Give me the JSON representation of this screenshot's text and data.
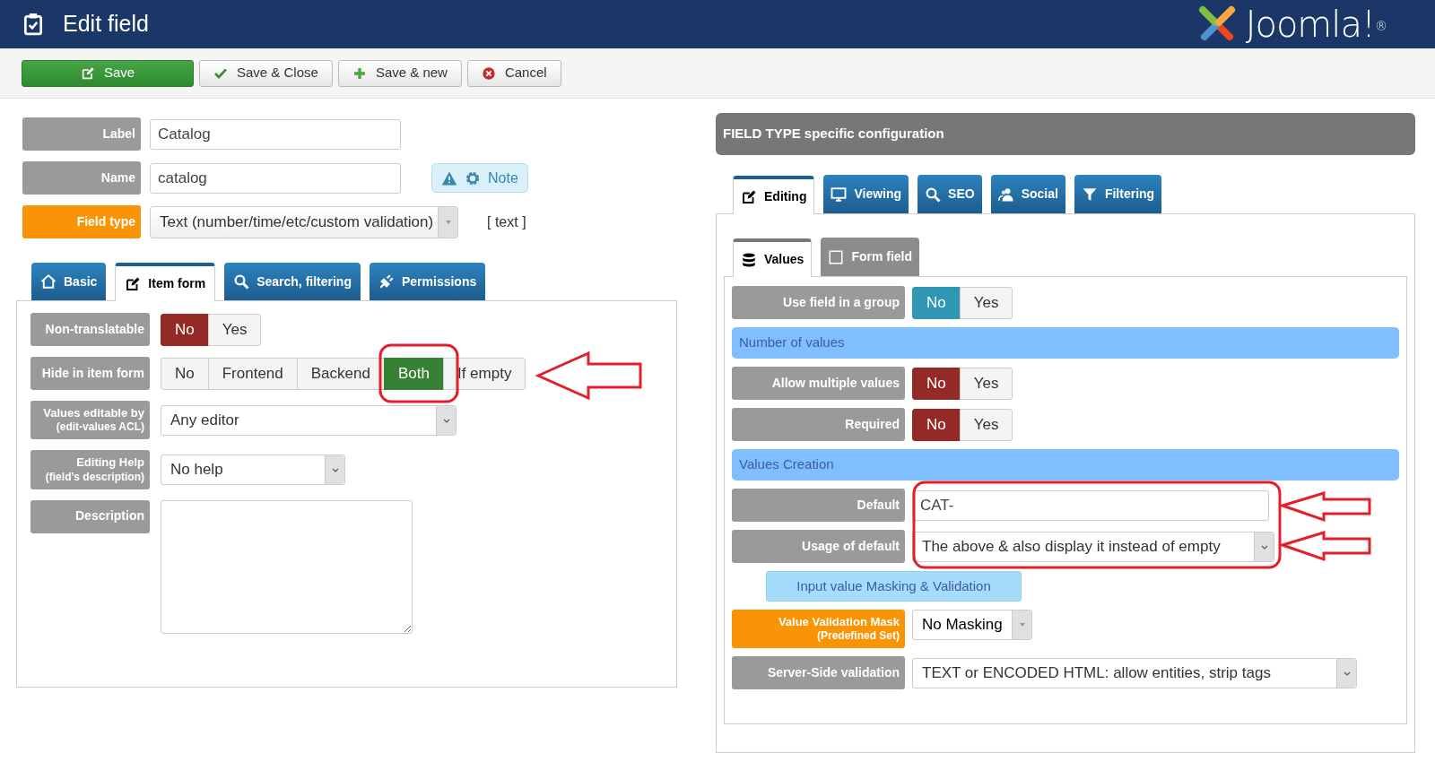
{
  "header": {
    "title": "Edit field",
    "logo_text": "Joomla!$^{®}$"
  },
  "toolbar": [
    {
      "label": "Save",
      "kind": "save"
    },
    {
      "label": "Save & Close",
      "kind": "close"
    },
    {
      "label": "Save & new",
      "kind": "new"
    },
    {
      "label": "Cancel",
      "kind": "cancel"
    }
  ],
  "left": {
    "fields": [
      {
        "label": "Label",
        "kind": "text",
        "value": "Catalog",
        "highlight": false
      },
      {
        "label": "Name",
        "kind": "text",
        "value": "catalog",
        "highlight": false,
        "note": "Note"
      },
      {
        "label": "Field type",
        "kind": "select",
        "value": "Text (number/time/etc/custom validation)",
        "highlight": true,
        "suffix": "[ text ]"
      }
    ],
    "tabs": [
      {
        "label": "Basic",
        "kind": "home",
        "selected": false
      },
      {
        "label": "Item form",
        "kind": "edit",
        "selected": true
      },
      {
        "label": "Search, filtering",
        "kind": "search",
        "selected": false
      },
      {
        "label": "Permissions",
        "kind": "plug",
        "selected": false
      }
    ],
    "rows": [
      {
        "label": "Non-translatable",
        "kind": "toggle",
        "color": "#942a25",
        "options": [
          {
            "label": "No",
            "selected": true
          },
          {
            "label": "Yes",
            "selected": false
          }
        ]
      },
      {
        "label": "Hide in item form",
        "kind": "toggle",
        "color": "#378137",
        "options": [
          {
            "label": "No",
            "selected": false
          },
          {
            "label": "Frontend",
            "selected": false
          },
          {
            "label": "Backend",
            "selected": false
          },
          {
            "label": "Both",
            "selected": true
          },
          {
            "label": "If empty",
            "selected": false
          }
        ]
      },
      {
        "label": "Values editable by",
        "sublabel": "(edit-values ACL)",
        "kind": "select",
        "value": "Any editor"
      },
      {
        "label": "Editing Help",
        "sublabel": "(field's description)",
        "kind": "select",
        "value": "No help"
      },
      {
        "label": "Description",
        "kind": "textarea"
      }
    ]
  },
  "right": {
    "title": "FIELD TYPE specific configuration",
    "tabs": [
      {
        "label": "Editing",
        "kind": "edit",
        "selected": true
      },
      {
        "label": "Viewing",
        "kind": "monitor",
        "selected": false
      },
      {
        "label": "SEO",
        "kind": "search",
        "selected": false
      },
      {
        "label": "Social",
        "kind": "users",
        "selected": false
      },
      {
        "label": "Filtering",
        "kind": "funnel",
        "selected": false
      }
    ],
    "subtabs": [
      {
        "label": "Values",
        "kind": "database",
        "selected": true
      },
      {
        "label": "Form field",
        "kind": "square",
        "selected": false
      }
    ],
    "rows": [
      {
        "label": "Use field in a group",
        "kind": "toggle",
        "color": "#2f96b4",
        "options": [
          {
            "label": "No",
            "selected": true
          },
          {
            "label": "Yes",
            "selected": false
          }
        ]
      },
      {
        "label": "Number of values",
        "kind": "section"
      },
      {
        "label": "Allow multiple values",
        "kind": "toggle",
        "color": "#942a25",
        "options": [
          {
            "label": "No",
            "selected": true
          },
          {
            "label": "Yes",
            "selected": false
          }
        ]
      },
      {
        "label": "Required",
        "kind": "toggle",
        "color": "#942a25",
        "options": [
          {
            "label": "No",
            "selected": true
          },
          {
            "label": "Yes",
            "selected": false
          }
        ]
      },
      {
        "label": "Values Creation",
        "kind": "section"
      },
      {
        "label": "Default",
        "kind": "text",
        "value": "CAT-"
      },
      {
        "label": "Usage of default",
        "kind": "select",
        "value": "The above & also display it instead of empty"
      },
      {
        "label": "Input value Masking & Validation",
        "kind": "subsection"
      },
      {
        "label": "Value Validation Mask",
        "sublabel": "(Predefined Set)",
        "kind": "dropdown",
        "value": "No Masking",
        "highlight": true
      },
      {
        "label": "Server-Side validation",
        "kind": "select",
        "value": "TEXT or ENCODED HTML: allow entities, strip tags"
      }
    ]
  }
}
